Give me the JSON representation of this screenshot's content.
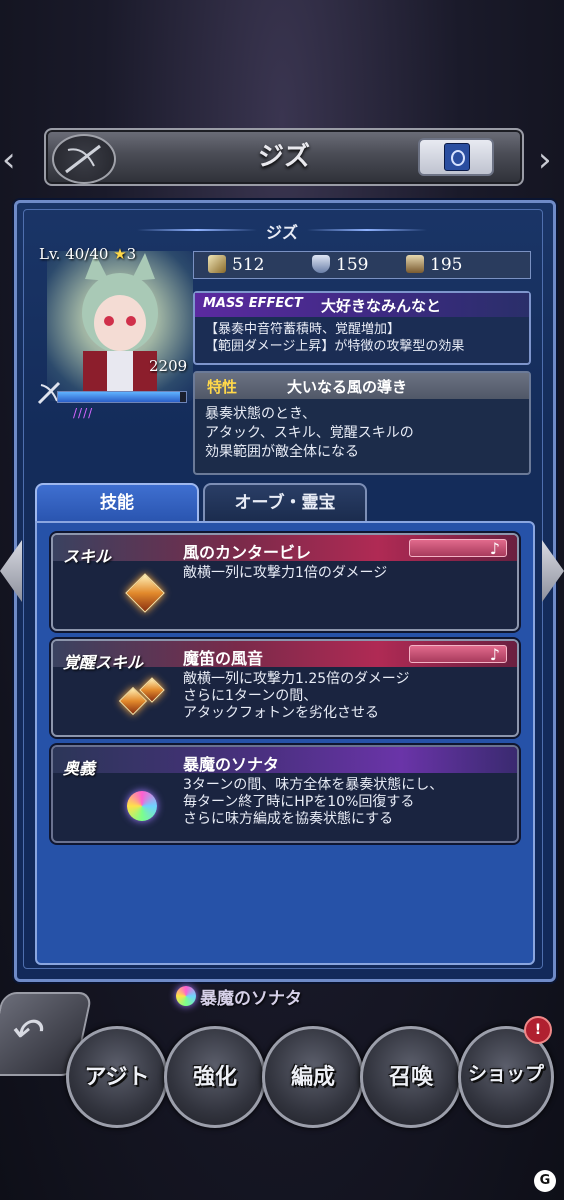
{
  "header": {
    "title": "ジズ"
  },
  "character": {
    "name": "ジズ",
    "level": "Lv. 40/40",
    "rarity_icon": "star-icon",
    "rarity": "3",
    "power": "2209",
    "hp_fraction": 0.95,
    "pips": "////"
  },
  "stats": {
    "attack": "512",
    "defense": "159",
    "speed": "195"
  },
  "mass_effect": {
    "label": "MASS EFFECT",
    "title": "大好きなみんなと",
    "desc_line1": "【暴奏中音符蓄積時、覚醒増加】",
    "desc_line2": "【範囲ダメージ上昇】が特徴の攻撃型の効果"
  },
  "trait": {
    "label": "特性",
    "title": "大いなる風の導き",
    "desc_line1": "暴奏状態のとき、",
    "desc_line2": "アタック、スキル、覚醒スキルの",
    "desc_line3": "効果範囲が敵全体になる"
  },
  "tabs": [
    {
      "label": "技能",
      "active": true
    },
    {
      "label": "オーブ・霊宝",
      "active": false
    }
  ],
  "skills": [
    {
      "type": "スキル",
      "name": "風のカンタービレ",
      "note": "♪",
      "desc_line1": "敵横一列に攻撃力1倍のダメージ",
      "desc_line2": "",
      "desc_line3": ""
    },
    {
      "type": "覚醒スキル",
      "name": "魔笛の風音",
      "note": "♪",
      "desc_line1": "敵横一列に攻撃力1.25倍のダメージ",
      "desc_line2": "さらに1ターンの間、",
      "desc_line3": "アタックフォトンを劣化させる"
    },
    {
      "type": "奥義",
      "name": "暴魔のソナタ",
      "desc_line1": "3ターンの間、味方全体を暴奏状態にし、",
      "desc_line2": "毎ターン終了時にHPを10%回復する",
      "desc_line3": "さらに味方編成を協奏状態にする"
    }
  ],
  "bottom": {
    "ultimate_label": "暴魔のソナタ",
    "nav": [
      {
        "label": "アジト"
      },
      {
        "label": "強化"
      },
      {
        "label": "編成"
      },
      {
        "label": "召喚"
      },
      {
        "label": "ショップ"
      }
    ],
    "badge": "!"
  },
  "colors": {
    "panel_bg": "#142c5a",
    "tab_active": "#2a55b0",
    "accent_pink": "#e16a8c",
    "accent_purple": "#5b2aa0",
    "gold": "#ffd84a"
  }
}
